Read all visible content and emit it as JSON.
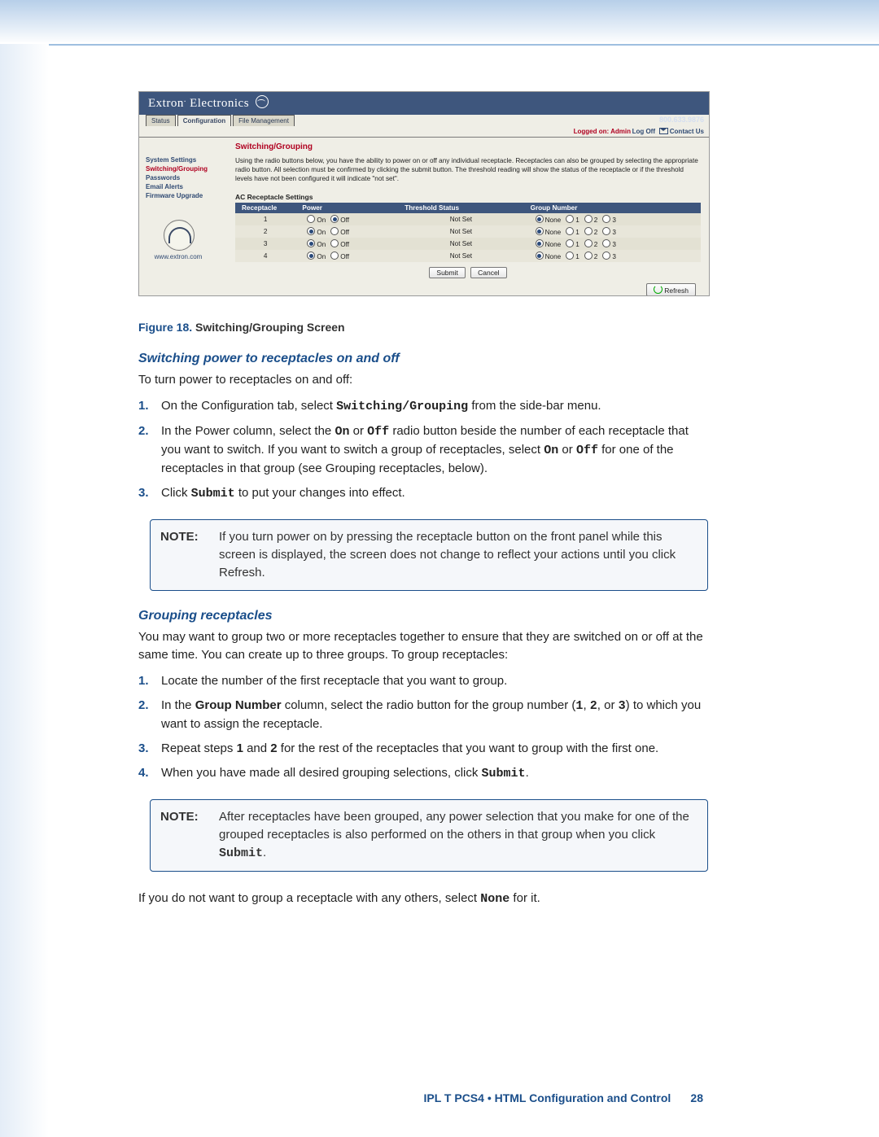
{
  "screenshot": {
    "brand_prefix": "Extron",
    "brand_suffix": "Electronics",
    "tabs": [
      "Status",
      "Configuration",
      "File Management"
    ],
    "phone": "800.633.9876",
    "logged_on_label": "Logged on:",
    "logged_on_user": "Admin",
    "log_off": "Log Off",
    "contact_us": "Contact Us",
    "sidebar": {
      "items": [
        "System Settings",
        "Switching/Grouping",
        "Passwords",
        "Email Alerts",
        "Firmware Upgrade"
      ],
      "url": "www.extron.com"
    },
    "panel": {
      "title": "Switching/Grouping",
      "intro": "Using the radio buttons below, you have the ability to power on or off any individual receptacle. Receptacles can also be grouped by selecting the appropriate radio button. All selection must be confirmed by clicking the submit button. The threshold reading will show the status of the receptacle or if the threshold levels have not been configured it will indicate \"not set\".",
      "table_title": "AC Receptacle Settings",
      "headers": {
        "r": "Receptacle",
        "p": "Power",
        "t": "Threshold Status",
        "g": "Group Number"
      },
      "power_labels": {
        "on": "On",
        "off": "Off"
      },
      "group_labels": {
        "none": "None",
        "g1": "1",
        "g2": "2",
        "g3": "3"
      },
      "rows": [
        {
          "n": "1",
          "power": "off",
          "thresh": "Not Set",
          "group": "none"
        },
        {
          "n": "2",
          "power": "on",
          "thresh": "Not Set",
          "group": "none"
        },
        {
          "n": "3",
          "power": "on",
          "thresh": "Not Set",
          "group": "none"
        },
        {
          "n": "4",
          "power": "on",
          "thresh": "Not Set",
          "group": "none"
        }
      ],
      "submit": "Submit",
      "cancel": "Cancel",
      "refresh": "Refresh"
    }
  },
  "fig_prefix": "Figure 18. ",
  "fig_title": "Switching/Grouping Screen",
  "sec1_title": "Switching power to receptacles on and off",
  "sec1_intro": "To turn power to receptacles on and off:",
  "sec1_steps": {
    "s1_a": "On the Configuration tab, select ",
    "s1_b": "Switching/Grouping",
    "s1_c": " from the side-bar menu.",
    "s2_a": "In the Power column, select the ",
    "s2_on": "On",
    "s2_mid": " or ",
    "s2_off": "Off",
    "s2_b": " radio button beside the number of each receptacle that you want to switch. If you want to switch a group of receptacles, select ",
    "s2_on2": "On",
    "s2_mid2": " or ",
    "s2_off2": "Off",
    "s2_c": " for one of the receptacles in that group (see Grouping receptacles, below).",
    "s3_a": "Click ",
    "s3_b": "Submit",
    "s3_c": " to put your changes into effect."
  },
  "note1_label": "NOTE:",
  "note1_body": "If you turn power on by pressing the receptacle button on the front panel while this screen is displayed, the screen does not change to reflect your actions until you click Refresh.",
  "sec2_title": "Grouping receptacles",
  "sec2_intro": "You may want to group two or more receptacles together to ensure that they are switched on or off at the same time. You can create up to three groups. To group receptacles:",
  "sec2_steps": {
    "s1": "Locate the number of the first receptacle that you want to group.",
    "s2_a": "In the ",
    "s2_b": "Group Number",
    "s2_c": " column, select the radio button for the group number (",
    "s2_1": "1",
    "s2_m1": ", ",
    "s2_2": "2",
    "s2_m2": ", or ",
    "s2_3": "3",
    "s2_d": ") to which you want to assign the receptacle.",
    "s3_a": "Repeat steps ",
    "s3_b": "1",
    "s3_c": " and ",
    "s3_d": "2",
    "s3_e": " for the rest of the receptacles that you want to group with the first one.",
    "s4_a": "When you have made all desired grouping selections, click ",
    "s4_b": "Submit",
    "s4_c": "."
  },
  "note2_label": "NOTE:",
  "note2_a": "After receptacles have been grouped, any power selection that you make for one of the grouped receptacles is also performed on the others in that group when you click ",
  "note2_b": "Submit",
  "note2_c": ".",
  "outro_a": "If you do not want to group a receptacle with any others, select ",
  "outro_b": "None",
  "outro_c": " for it.",
  "footer": "IPL T PCS4 • HTML Configuration and Control",
  "page_no": "28"
}
